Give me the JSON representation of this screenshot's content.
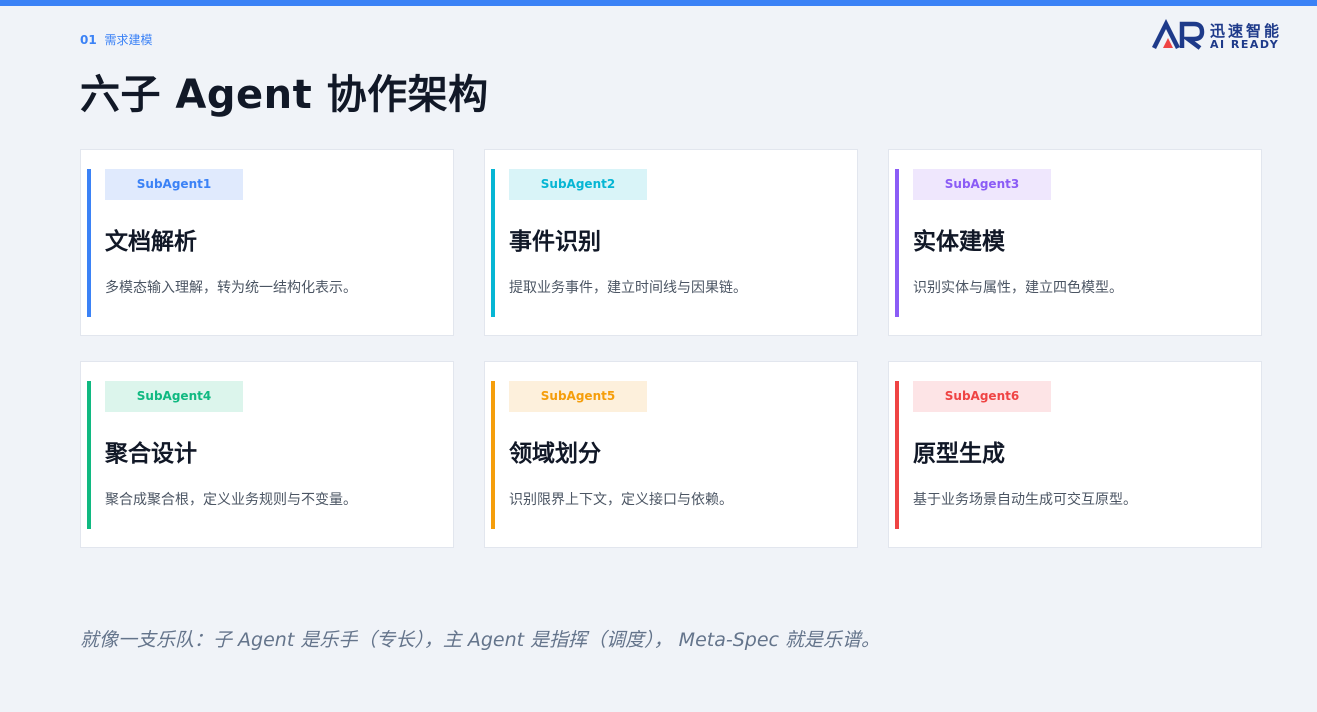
{
  "header": {
    "section_number": "01",
    "section_name": "需求建模",
    "title": "六子 Agent 协作架构"
  },
  "logo": {
    "cn": "迅速智能",
    "en": "AI READY",
    "mark_color": "#1e3a8a",
    "accent_color": "#ef4444"
  },
  "cards": [
    {
      "badge": "SubAgent1",
      "title": "文档解析",
      "desc": "多模态输入理解，转为统一结构化表示。",
      "color": "#3b82f6",
      "badge_bg": "#e0eafd"
    },
    {
      "badge": "SubAgent2",
      "title": "事件识别",
      "desc": "提取业务事件，建立时间线与因果链。",
      "color": "#06b6d4",
      "badge_bg": "#d9f4f8"
    },
    {
      "badge": "SubAgent3",
      "title": "实体建模",
      "desc": "识别实体与属性，建立四色模型。",
      "color": "#8b5cf6",
      "badge_bg": "#efe7fd"
    },
    {
      "badge": "SubAgent4",
      "title": "聚合设计",
      "desc": "聚合成聚合根，定义业务规则与不变量。",
      "color": "#10b981",
      "badge_bg": "#dcf5ec"
    },
    {
      "badge": "SubAgent5",
      "title": "领域划分",
      "desc": "识别限界上下文，定义接口与依赖。",
      "color": "#f59e0b",
      "badge_bg": "#fdf0dc"
    },
    {
      "badge": "SubAgent6",
      "title": "原型生成",
      "desc": "基于业务场景自动生成可交互原型。",
      "color": "#ef4444",
      "badge_bg": "#fde4e6"
    }
  ],
  "footer": {
    "quote": "就像一支乐队：子 Agent 是乐手（专长），主 Agent 是指挥（调度）， Meta-Spec 就是乐谱。"
  },
  "colors": {
    "top_bar": "#3b82f6",
    "background": "#f0f3f8"
  }
}
